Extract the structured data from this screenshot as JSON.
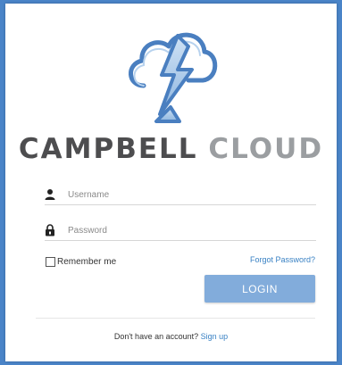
{
  "brand": {
    "word1": "CAMPBELL",
    "word2": "CLOUD",
    "icon": "cloud-lightning-logo"
  },
  "form": {
    "username": {
      "placeholder": "Username",
      "value": "",
      "icon": "user-icon"
    },
    "password": {
      "placeholder": "Password",
      "value": "",
      "icon": "lock-icon"
    },
    "remember_label": "Remember me",
    "remember_checked": false,
    "forgot_label": "Forgot Password?",
    "login_label": "LOGIN"
  },
  "footer": {
    "prompt": "Don't have an account?",
    "signup_label": "Sign up"
  },
  "colors": {
    "background": "#4a84c8",
    "accent": "#3a82c4",
    "button": "#82acdb",
    "brand_dark": "#4d4d4f",
    "brand_light": "#9b9ea1"
  }
}
